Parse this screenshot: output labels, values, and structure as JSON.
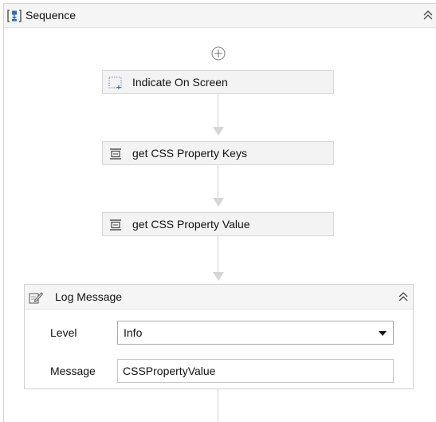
{
  "sequence": {
    "title": "Sequence",
    "collapse_icon": "double-chevron-up-icon"
  },
  "add_icon": "plus-circle-icon",
  "activities": [
    {
      "label": "Indicate On Screen",
      "icon": "dotted-selection-icon"
    },
    {
      "label": "get CSS Property Keys",
      "icon": "invoke-activity-icon"
    },
    {
      "label": "get CSS Property Value",
      "icon": "invoke-activity-icon"
    }
  ],
  "log_message": {
    "title": "Log Message",
    "icon": "log-note-pencil-icon",
    "collapse_icon": "double-chevron-up-icon",
    "level_label": "Level",
    "level_value": "Info",
    "message_label": "Message",
    "message_value": "CSSPropertyValue"
  },
  "colors": {
    "header_bg": "#f5f5f5",
    "activity_bg": "#f3f3f3",
    "accent_blue": "#2f6db5",
    "connector": "#cfcfcf"
  }
}
